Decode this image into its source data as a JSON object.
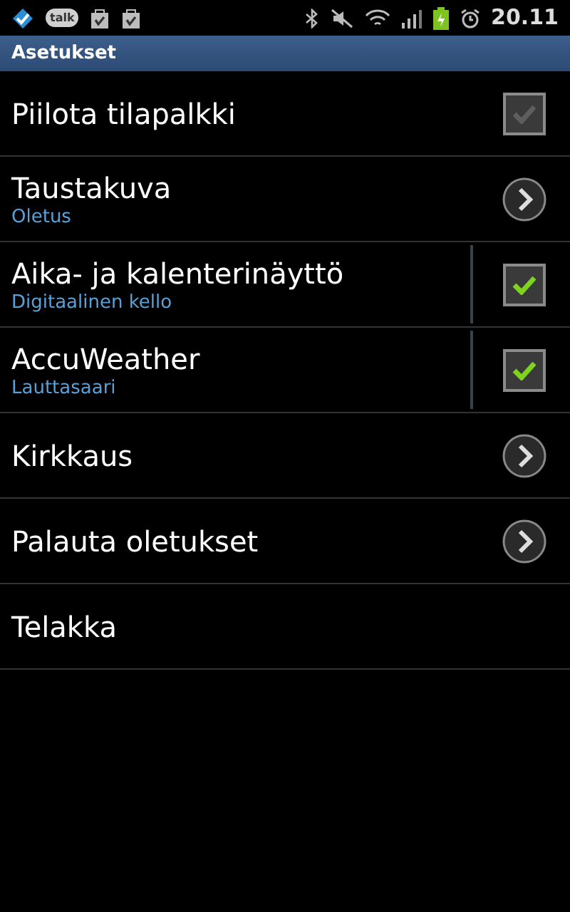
{
  "status_bar": {
    "chat_label": "talk",
    "time": "20.11"
  },
  "title": "Asetukset",
  "items": [
    {
      "kind": "checkbox",
      "label": "Piilota tilapalkki",
      "checked": false
    },
    {
      "kind": "link",
      "label": "Taustakuva",
      "summary": "Oletus"
    },
    {
      "kind": "checkbox",
      "label": "Aika- ja kalenterinäyttö",
      "summary": "Digitaalinen kello",
      "checked": true
    },
    {
      "kind": "checkbox",
      "label": "AccuWeather",
      "summary": "Lauttasaari",
      "checked": true
    },
    {
      "kind": "link",
      "label": "Kirkkaus"
    },
    {
      "kind": "link",
      "label": "Palauta oletukset"
    },
    {
      "kind": "plain",
      "label": "Telakka"
    }
  ]
}
